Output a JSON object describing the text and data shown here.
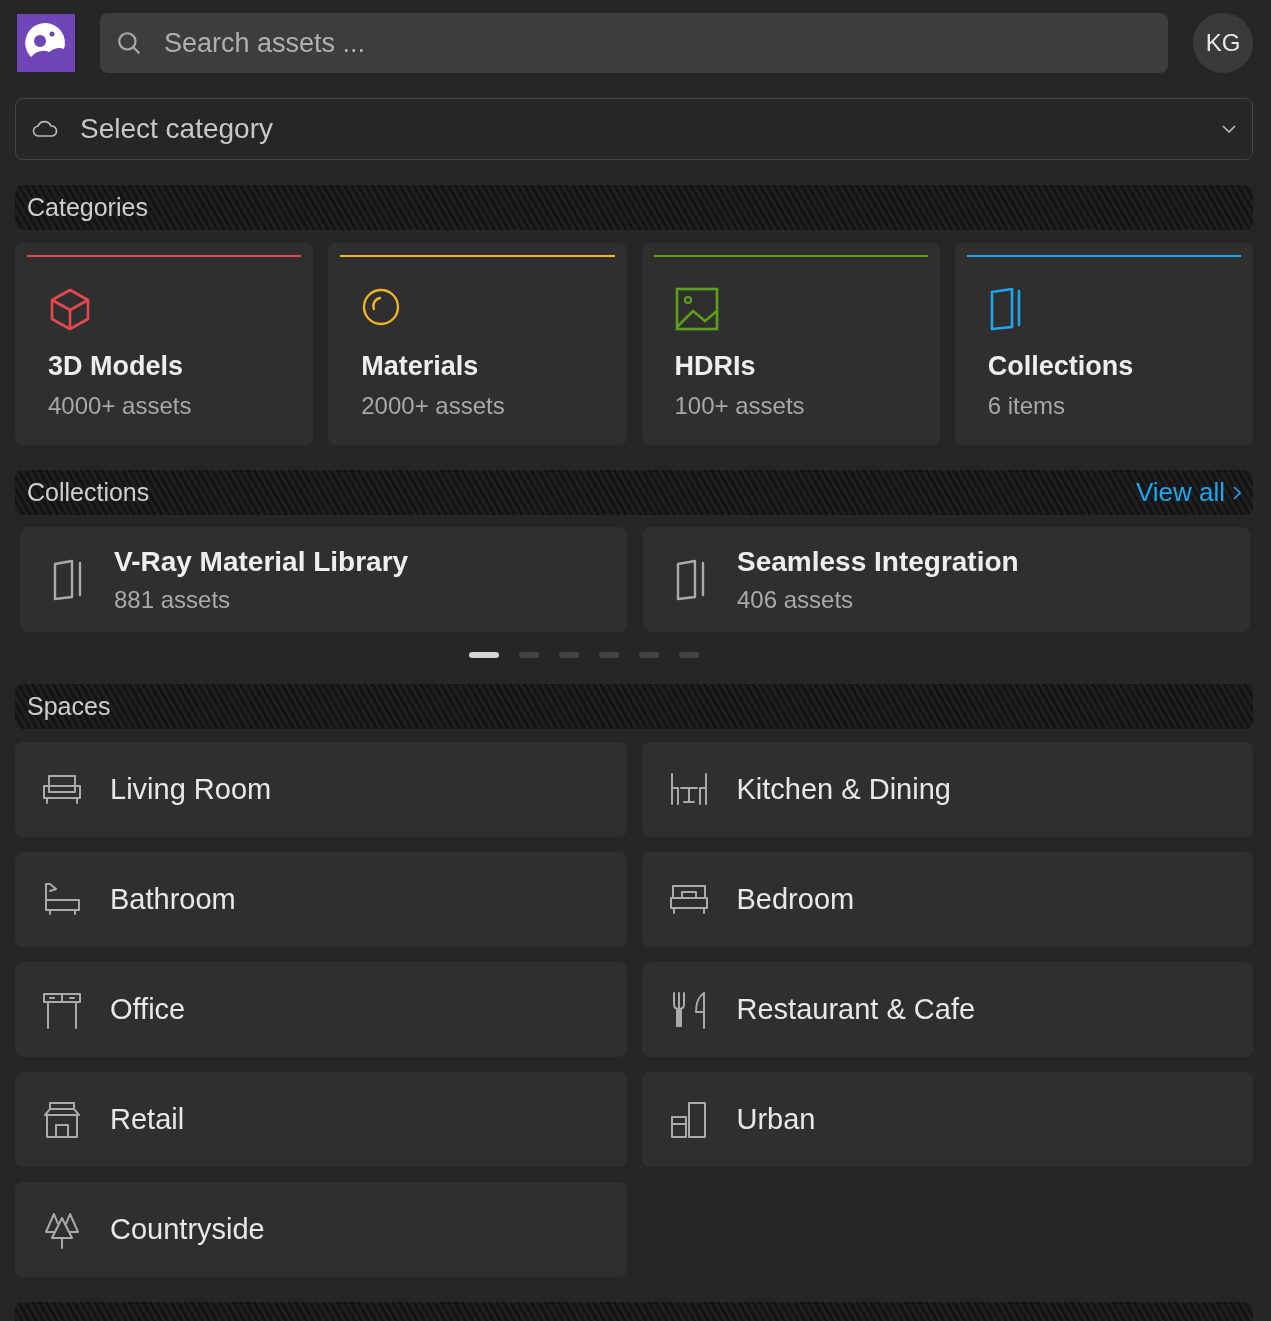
{
  "search": {
    "placeholder": "Search assets ..."
  },
  "avatar": {
    "initials": "KG"
  },
  "category_select": {
    "placeholder": "Select category"
  },
  "categories": {
    "title": "Categories",
    "items": [
      {
        "name": "3D Models",
        "count": "4000+ assets",
        "color": "#e5484d"
      },
      {
        "name": "Materials",
        "count": "2000+ assets",
        "color": "#f0b429"
      },
      {
        "name": "HDRIs",
        "count": "100+ assets",
        "color": "#5aa01a"
      },
      {
        "name": "Collections",
        "count": "6 items",
        "color": "#1ea7f0"
      }
    ]
  },
  "collections": {
    "title": "Collections",
    "view_all": "View all",
    "items": [
      {
        "name": "V-Ray Material Library",
        "count": "881 assets"
      },
      {
        "name": "Seamless Integration",
        "count": "406 assets"
      }
    ],
    "pages": [
      {
        "selected": true
      },
      {
        "selected": false
      },
      {
        "selected": false
      },
      {
        "selected": false
      },
      {
        "selected": false
      },
      {
        "selected": false
      }
    ]
  },
  "spaces": {
    "title": "Spaces",
    "items": [
      {
        "name": "Living Room"
      },
      {
        "name": "Kitchen & Dining"
      },
      {
        "name": "Bathroom"
      },
      {
        "name": "Bedroom"
      },
      {
        "name": "Office"
      },
      {
        "name": "Restaurant & Cafe"
      },
      {
        "name": "Retail"
      },
      {
        "name": "Urban"
      },
      {
        "name": "Countryside"
      }
    ]
  }
}
